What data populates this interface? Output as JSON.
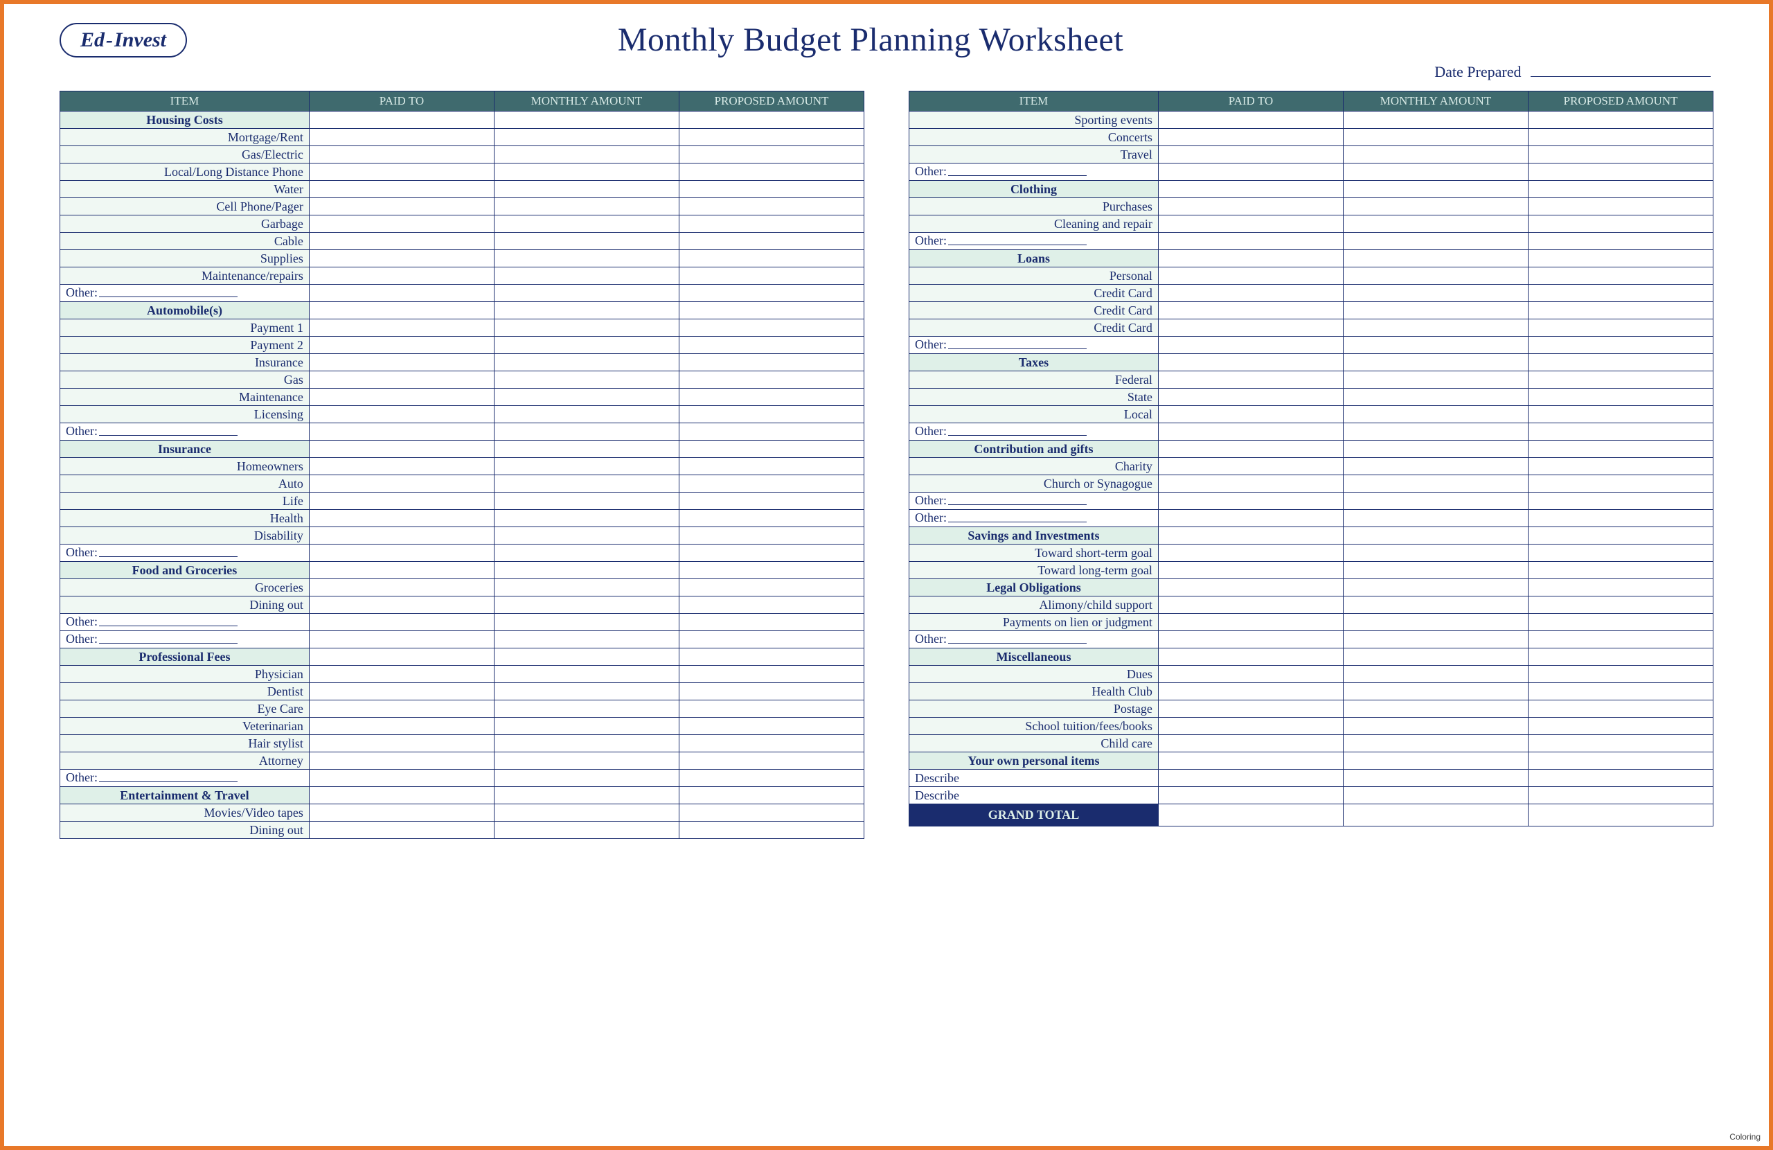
{
  "brand": {
    "part1": "Ed",
    "dash": "-",
    "part2": "Invest"
  },
  "title": "Monthly Budget Planning Worksheet",
  "date_prepared_label": "Date Prepared",
  "footer_text": "Coloring",
  "headers": {
    "item": "ITEM",
    "paid_to": "PAID TO",
    "monthly_amount": "MONTHLY AMOUNT",
    "proposed_amount": "PROPOSED AMOUNT"
  },
  "other_label": "Other:",
  "describe_label": "Describe",
  "grand_total_label": "GRAND TOTAL",
  "left_rows": [
    {
      "type": "section",
      "label": "Housing Costs"
    },
    {
      "type": "line",
      "label": "Mortgage/Rent"
    },
    {
      "type": "line",
      "label": "Gas/Electric"
    },
    {
      "type": "line",
      "label": "Local/Long Distance Phone"
    },
    {
      "type": "line",
      "label": "Water"
    },
    {
      "type": "line",
      "label": "Cell Phone/Pager"
    },
    {
      "type": "line",
      "label": "Garbage"
    },
    {
      "type": "line",
      "label": "Cable"
    },
    {
      "type": "line",
      "label": "Supplies"
    },
    {
      "type": "line",
      "label": "Maintenance/repairs"
    },
    {
      "type": "other"
    },
    {
      "type": "section",
      "label": "Automobile(s)"
    },
    {
      "type": "line",
      "label": "Payment 1"
    },
    {
      "type": "line",
      "label": "Payment 2"
    },
    {
      "type": "line",
      "label": "Insurance"
    },
    {
      "type": "line",
      "label": "Gas"
    },
    {
      "type": "line",
      "label": "Maintenance"
    },
    {
      "type": "line",
      "label": "Licensing"
    },
    {
      "type": "other"
    },
    {
      "type": "section",
      "label": "Insurance"
    },
    {
      "type": "line",
      "label": "Homeowners"
    },
    {
      "type": "line",
      "label": "Auto"
    },
    {
      "type": "line",
      "label": "Life"
    },
    {
      "type": "line",
      "label": "Health"
    },
    {
      "type": "line",
      "label": "Disability"
    },
    {
      "type": "other"
    },
    {
      "type": "section",
      "label": "Food and Groceries"
    },
    {
      "type": "line",
      "label": "Groceries"
    },
    {
      "type": "line",
      "label": "Dining out"
    },
    {
      "type": "other"
    },
    {
      "type": "other"
    },
    {
      "type": "section",
      "label": "Professional Fees"
    },
    {
      "type": "line",
      "label": "Physician"
    },
    {
      "type": "line",
      "label": "Dentist"
    },
    {
      "type": "line",
      "label": "Eye Care"
    },
    {
      "type": "line",
      "label": "Veterinarian"
    },
    {
      "type": "line",
      "label": "Hair stylist"
    },
    {
      "type": "line",
      "label": "Attorney"
    },
    {
      "type": "other"
    },
    {
      "type": "section",
      "label": "Entertainment & Travel"
    },
    {
      "type": "line",
      "label": "Movies/Video tapes"
    },
    {
      "type": "line",
      "label": "Dining out"
    }
  ],
  "right_rows": [
    {
      "type": "line",
      "label": "Sporting events"
    },
    {
      "type": "line",
      "label": "Concerts"
    },
    {
      "type": "line",
      "label": "Travel"
    },
    {
      "type": "other"
    },
    {
      "type": "section",
      "label": "Clothing"
    },
    {
      "type": "line",
      "label": "Purchases"
    },
    {
      "type": "line",
      "label": "Cleaning and repair"
    },
    {
      "type": "other"
    },
    {
      "type": "section",
      "label": "Loans"
    },
    {
      "type": "line",
      "label": "Personal"
    },
    {
      "type": "line",
      "label": "Credit Card"
    },
    {
      "type": "line",
      "label": "Credit Card"
    },
    {
      "type": "line",
      "label": "Credit Card"
    },
    {
      "type": "other"
    },
    {
      "type": "section",
      "label": "Taxes"
    },
    {
      "type": "line",
      "label": "Federal"
    },
    {
      "type": "line",
      "label": "State"
    },
    {
      "type": "line",
      "label": "Local"
    },
    {
      "type": "other"
    },
    {
      "type": "section",
      "label": "Contribution and gifts"
    },
    {
      "type": "line",
      "label": "Charity"
    },
    {
      "type": "line",
      "label": "Church or Synagogue"
    },
    {
      "type": "other"
    },
    {
      "type": "other"
    },
    {
      "type": "section",
      "label": "Savings and Investments"
    },
    {
      "type": "line",
      "label": "Toward short-term goal"
    },
    {
      "type": "line",
      "label": "Toward long-term goal"
    },
    {
      "type": "section",
      "label": "Legal Obligations"
    },
    {
      "type": "line",
      "label": "Alimony/child support"
    },
    {
      "type": "line",
      "label": "Payments on lien or judgment"
    },
    {
      "type": "other"
    },
    {
      "type": "section",
      "label": "Miscellaneous"
    },
    {
      "type": "line",
      "label": "Dues"
    },
    {
      "type": "line",
      "label": "Health Club"
    },
    {
      "type": "line",
      "label": "Postage"
    },
    {
      "type": "line",
      "label": "School tuition/fees/books"
    },
    {
      "type": "line",
      "label": "Child care"
    },
    {
      "type": "section",
      "label": "Your own personal items"
    },
    {
      "type": "describe"
    },
    {
      "type": "describe"
    },
    {
      "type": "grand"
    }
  ]
}
